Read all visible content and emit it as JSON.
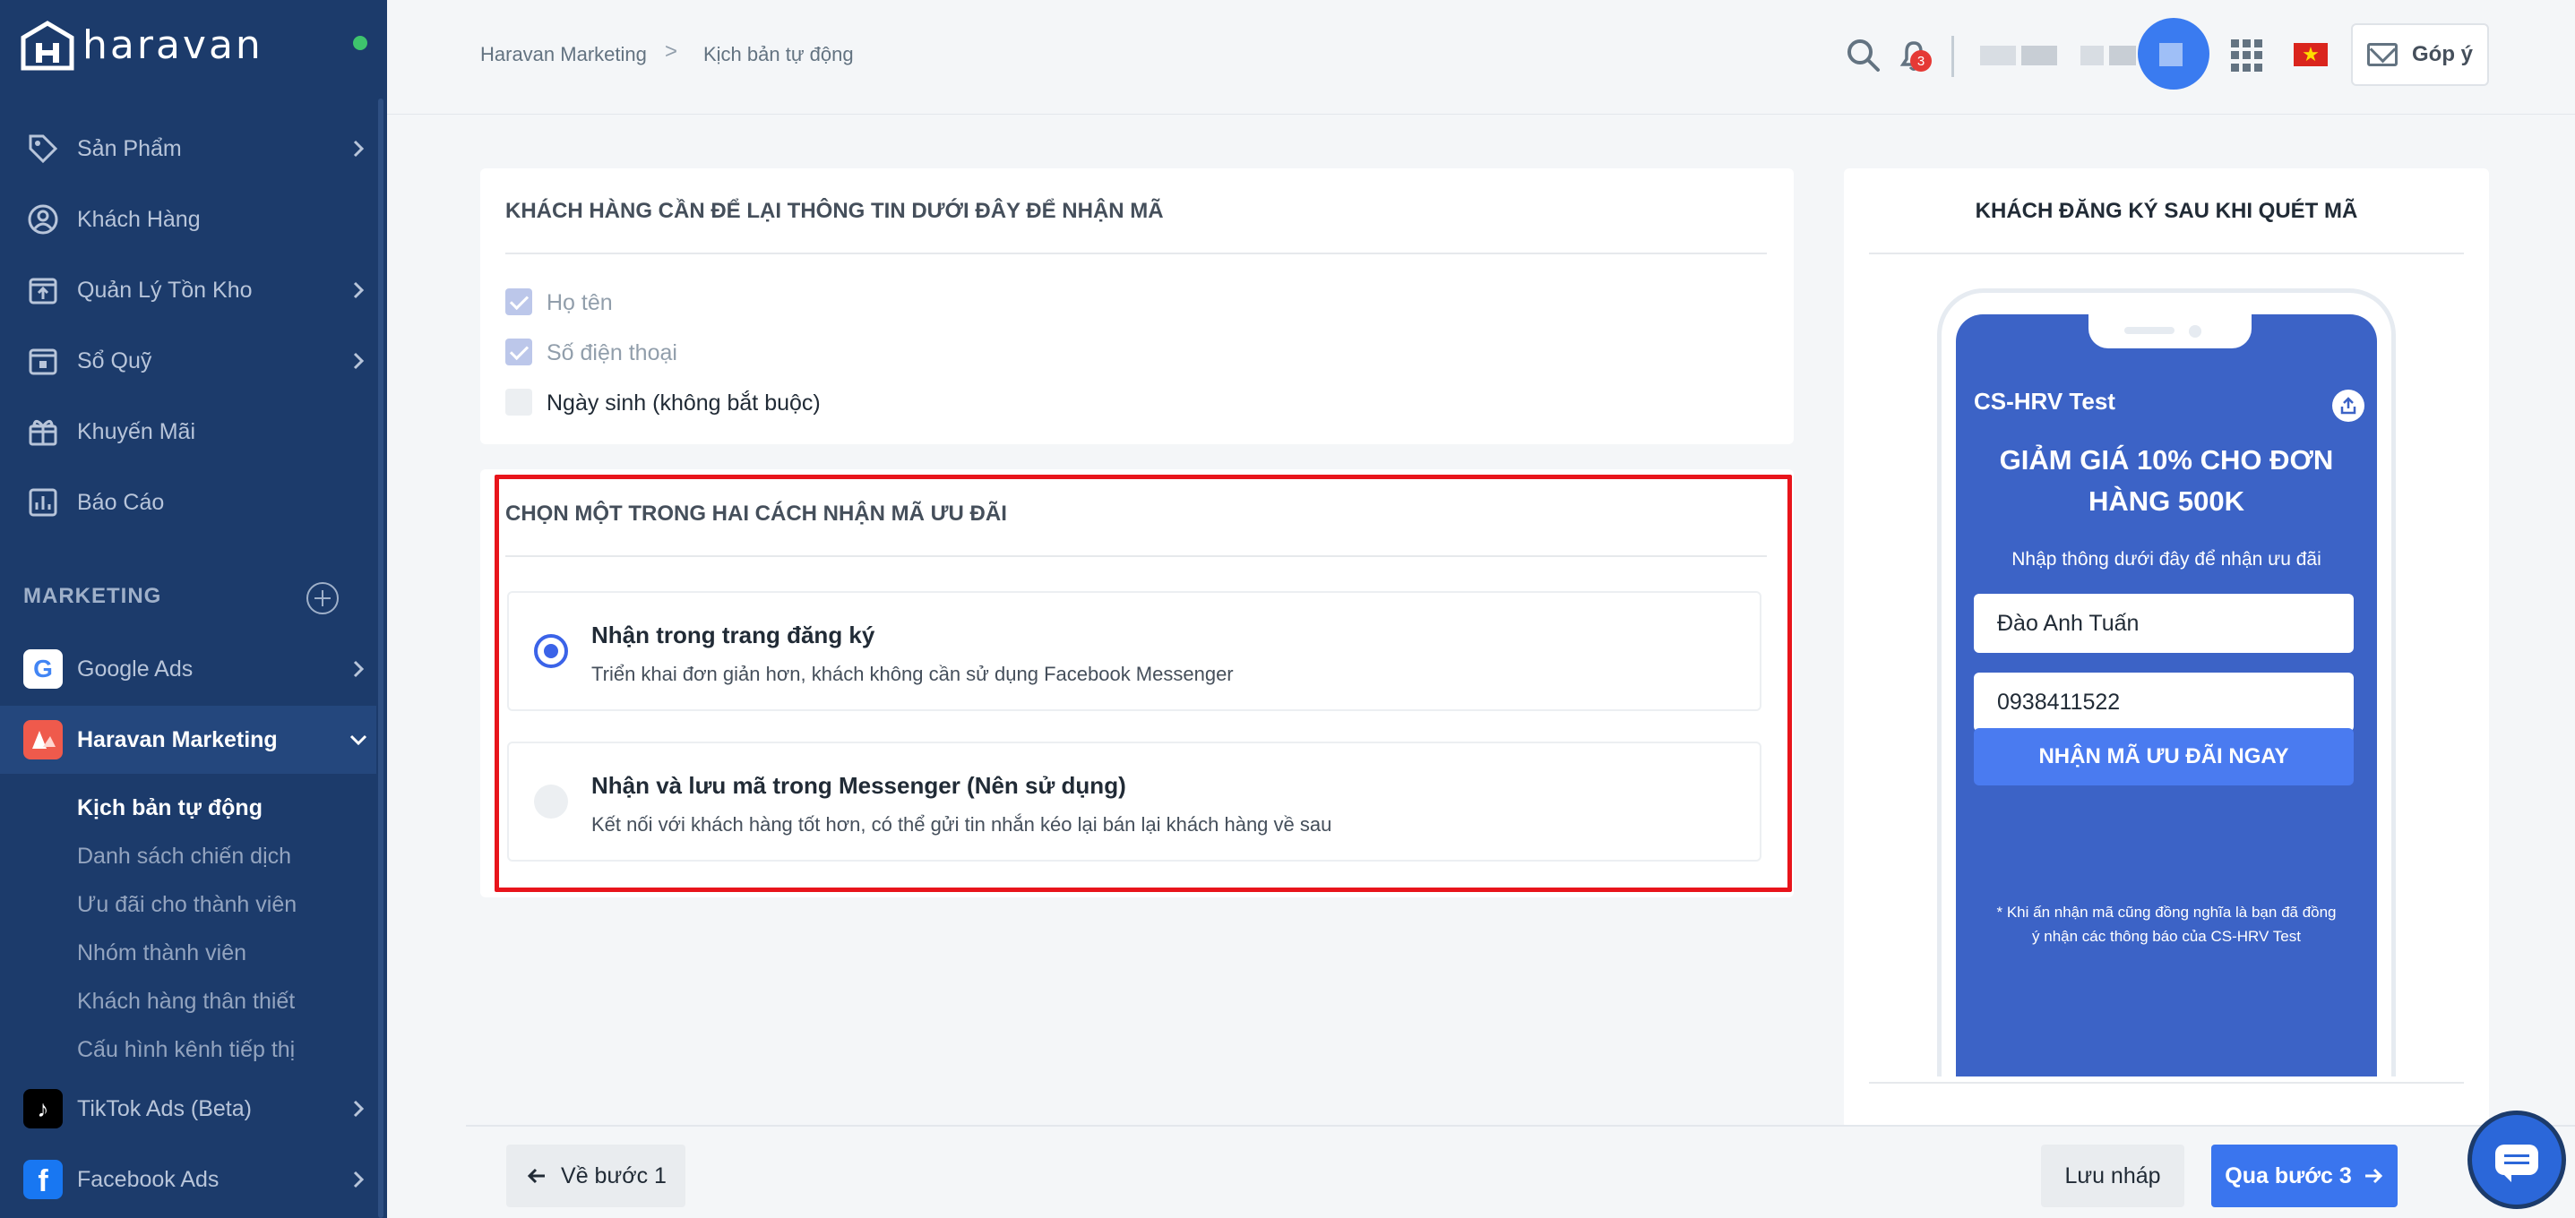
{
  "app": {
    "logo_text": "haravan"
  },
  "sidebar": {
    "items": [
      {
        "label": "Sản Phẩm",
        "icon": "tag-icon"
      },
      {
        "label": "Khách Hàng",
        "icon": "user-icon"
      },
      {
        "label": "Quản Lý Tồn Kho",
        "icon": "inventory-icon"
      },
      {
        "label": "Sổ Quỹ",
        "icon": "cashbook-icon"
      },
      {
        "label": "Khuyến Mãi",
        "icon": "gift-icon"
      },
      {
        "label": "Báo Cáo",
        "icon": "report-icon"
      }
    ],
    "section_label": "MARKETING",
    "channels": [
      {
        "label": "Google Ads",
        "icon": "google-icon"
      },
      {
        "label": "Haravan Marketing",
        "icon": "haravan-marketing-icon"
      },
      {
        "label": "TikTok Ads (Beta)",
        "icon": "tiktok-icon"
      },
      {
        "label": "Facebook Ads",
        "icon": "facebook-icon"
      }
    ],
    "sub_items": [
      {
        "label": "Kịch bản tự động"
      },
      {
        "label": "Danh sách chiến dịch"
      },
      {
        "label": "Ưu đãi cho thành viên"
      },
      {
        "label": "Nhóm thành viên"
      },
      {
        "label": "Khách hàng thân thiết"
      },
      {
        "label": "Cấu hình kênh tiếp thị"
      }
    ]
  },
  "breadcrumb": {
    "root": "Haravan Marketing",
    "separator": ">",
    "current": "Kịch bản tự động"
  },
  "topbar": {
    "notification_count": "3",
    "feedback_label": "Góp ý",
    "flag_symbol": "★"
  },
  "info_card": {
    "title": "KHÁCH HÀNG CẦN ĐỂ LẠI THÔNG TIN DƯỚI ĐÂY ĐỂ NHẬN MÃ",
    "fields": [
      {
        "label": "Họ tên",
        "checked": true
      },
      {
        "label": "Số điện thoại",
        "checked": true
      },
      {
        "label": "Ngày sinh (không bắt buộc)",
        "checked": false
      }
    ]
  },
  "method_card": {
    "title": "CHỌN MỘT TRONG HAI CÁCH NHẬN MÃ ƯU ĐÃI",
    "options": [
      {
        "title": "Nhận trong trang đăng ký",
        "description": "Triển khai đơn giản hơn, khách không cần sử dụng Facebook Messenger",
        "selected": true
      },
      {
        "title": "Nhận và lưu mã trong Messenger (Nên sử dụng)",
        "description": "Kết nối với khách hàng tốt hơn, có thể gửi tin nhắn kéo lại bán lại khách hàng về sau",
        "selected": false
      }
    ]
  },
  "preview": {
    "title": "KHÁCH ĐĂNG KÝ SAU KHI QUÉT MÃ",
    "shop_name": "CS-HRV Test",
    "promo_title": "GIẢM GIÁ 10% CHO ĐƠN HÀNG 500K",
    "promo_subtitle": "Nhập thông dưới đây để nhận ưu đãi",
    "name_value": "Đào Anh Tuấn",
    "phone_value": "0938411522",
    "cta_label": "NHẬN MÃ ƯU ĐÃI NGAY",
    "disclaimer": "* Khi ấn nhận mã cũng đồng nghĩa là bạn đã đồng ý nhận các thông báo của CS-HRV Test"
  },
  "footer": {
    "back_label": "Về bước 1",
    "draft_label": "Lưu nháp",
    "next_label": "Qua bước 3"
  },
  "colors": {
    "sidebar_bg": "#1c3b6b",
    "primary": "#3a75ee",
    "highlight": "#e8141b",
    "phone_screen": "#3c63c6"
  }
}
